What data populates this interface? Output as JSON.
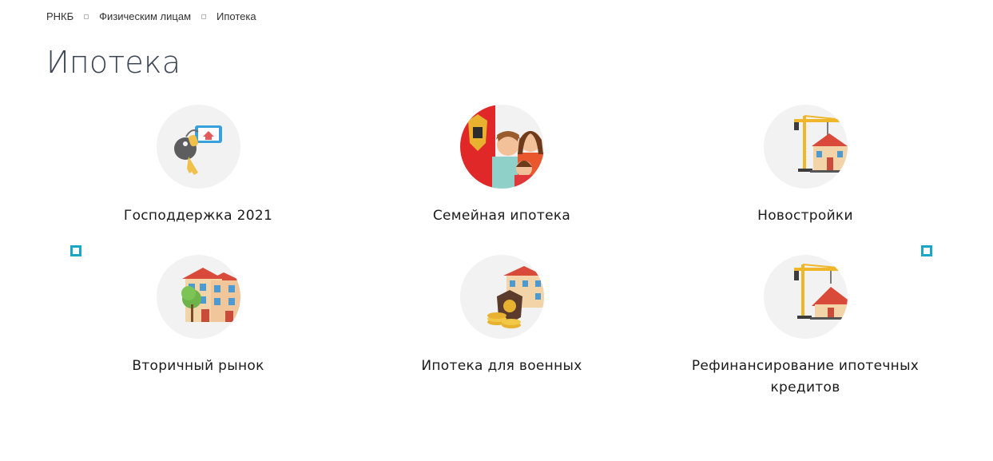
{
  "breadcrumb": {
    "items": [
      "РНКБ",
      "Физическим лицам",
      "Ипотека"
    ]
  },
  "page": {
    "title": "Ипотека"
  },
  "products": [
    {
      "label": "Господдержка 2021",
      "icon": "keys-house-icon"
    },
    {
      "label": "Семейная ипотека",
      "icon": "family-emblem-icon"
    },
    {
      "label": "Новостройки",
      "icon": "crane-building-icon"
    },
    {
      "label": "Вторичный рынок",
      "icon": "house-tree-icon"
    },
    {
      "label": "Ипотека для военных",
      "icon": "military-house-coins-icon"
    },
    {
      "label": "Рефинансирование ипотечных кредитов",
      "icon": "crane-house-icon"
    }
  ],
  "colors": {
    "accent": "#1aa6c7",
    "circle": "#f2f2f2",
    "title": "#3c4654"
  }
}
